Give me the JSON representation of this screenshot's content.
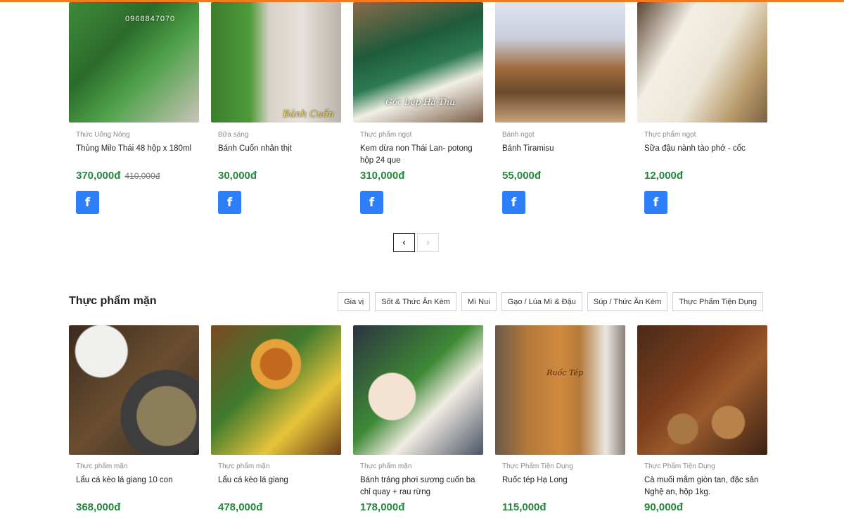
{
  "brand_color": "#f47920",
  "price_color": "#23883c",
  "row1": [
    {
      "category": "Thức Uống Nóng",
      "name": "Thùng Milo Thái 48 hộp x 180ml",
      "price": "370,000đ",
      "old_price": "410,000đ",
      "image_text": "0968847070",
      "image_text2": ""
    },
    {
      "category": "Bữa sáng",
      "name": "Bánh Cuốn nhân thịt",
      "price": "30,000đ",
      "old_price": "",
      "image_text": "",
      "image_text2": "Bánh Cuốn"
    },
    {
      "category": "Thực phẩm ngọt",
      "name": "Kem dừa non Thái Lan- potong hộp 24 que",
      "price": "310,000đ",
      "old_price": "",
      "image_text": "Góc bếp Hà Thu",
      "image_text2": ""
    },
    {
      "category": "Bánh ngọt",
      "name": "Bánh Tiramisu",
      "price": "55,000đ",
      "old_price": "",
      "image_text": "",
      "image_text2": ""
    },
    {
      "category": "Thực phẩm ngọt",
      "name": "Sữa đậu nành tào phớ - cốc",
      "price": "12,000đ",
      "old_price": "",
      "image_text": "",
      "image_text2": ""
    }
  ],
  "share_icon": "facebook-icon",
  "pagination": {
    "prev": "‹",
    "next": "›"
  },
  "section": {
    "title": "Thực phẩm mặn",
    "filters": [
      "Gia vị",
      "Sốt & Thức Ăn Kèm",
      "Mì Nui",
      "Gạo / Lúa Mì & Đậu",
      "Súp / Thức Ăn Kèm",
      "Thực Phẩm Tiện Dụng"
    ]
  },
  "row2": [
    {
      "category": "Thực phẩm mặn",
      "name": "Lẩu cá kèo lá giang 10 con",
      "price": "368,000đ"
    },
    {
      "category": "Thực phẩm mặn",
      "name": "Lẩu cá kèo lá giang",
      "price": "478,000đ"
    },
    {
      "category": "Thực phẩm mặn",
      "name": "Bánh tráng phơi sương cuốn ba chỉ quay + rau rừng",
      "price": "178,000đ"
    },
    {
      "category": "Thực Phẩm Tiện Dụng",
      "name": "Ruốc tép Hạ Long",
      "price": "115,000đ",
      "image_text": "Ruốc Tép"
    },
    {
      "category": "Thực Phẩm Tiện Dụng",
      "name": "Cà muối mắm giòn tan, đặc sản Nghệ an, hộp 1kg.",
      "price": "90,000đ"
    }
  ]
}
